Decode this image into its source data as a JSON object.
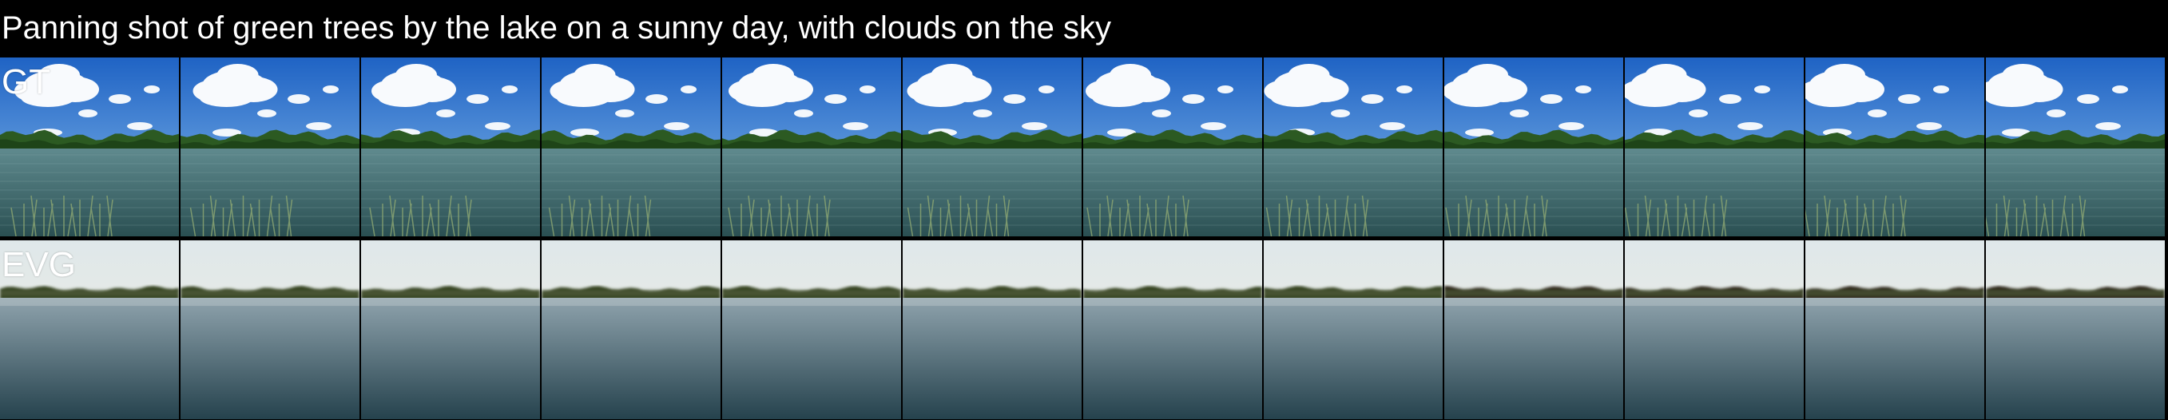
{
  "caption": "Panning shot of green trees by the lake on a sunny day, with clouds on the sky",
  "rows": [
    {
      "label": "GT",
      "type": "gt",
      "frame_count": 12
    },
    {
      "label": "EVG",
      "type": "evg",
      "frame_count": 12
    }
  ],
  "colors": {
    "background": "#000000",
    "text": "#ffffff",
    "gt_sky_top": "#1f63c4",
    "gt_sky_bottom": "#8cc0ee",
    "gt_trees": "#2c5a22",
    "gt_water_top": "#5f8a8e",
    "gt_water_bottom": "#2a4f52",
    "gt_grass": "#8ea873",
    "evg_sky_top": "#dfe8ea",
    "evg_sky_bottom": "#f1ede0",
    "evg_trees": "#33401f",
    "evg_water_top": "#8fa3ad",
    "evg_water_bottom": "#25424d"
  }
}
